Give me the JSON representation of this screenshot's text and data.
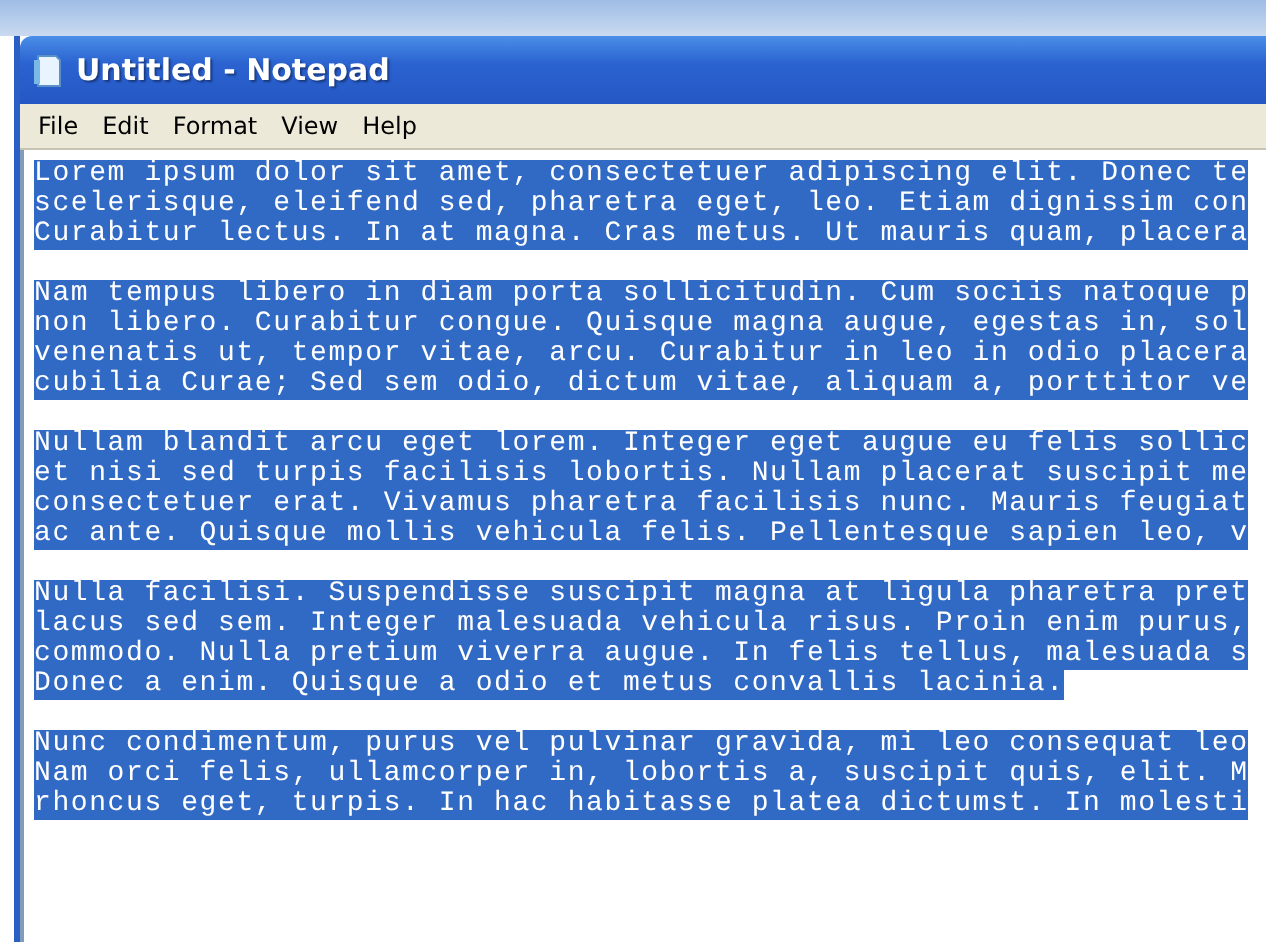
{
  "window": {
    "title": "Untitled - Notepad"
  },
  "menu": [
    "File",
    "Edit",
    "Format",
    "View",
    "Help"
  ],
  "paragraphs": [
    {
      "lines": [
        {
          "text": "Lorem ipsum dolor sit amet, consectetuer adipiscing elit. Donec te",
          "selected": true
        },
        {
          "text": "scelerisque, eleifend sed, pharetra eget, leo. Etiam dignissim con",
          "selected": true
        },
        {
          "text": "Curabitur lectus. In at magna. Cras metus. Ut mauris quam, placera",
          "selected": true
        }
      ]
    },
    {
      "lines": [
        {
          "text": "Nam tempus libero in diam porta sollicitudin. Cum sociis natoque p",
          "selected": true
        },
        {
          "text": "non libero. Curabitur congue. Quisque magna augue, egestas in, sol",
          "selected": true
        },
        {
          "text": "venenatis ut, tempor vitae, arcu. Curabitur in leo in odio placera",
          "selected": true
        },
        {
          "text": "cubilia Curae; Sed sem odio, dictum vitae, aliquam a, porttitor ve",
          "selected": true
        }
      ]
    },
    {
      "lines": [
        {
          "text": "Nullam blandit arcu eget lorem. Integer eget augue eu felis sollic",
          "selected": true
        },
        {
          "text": "et nisi sed turpis facilisis lobortis. Nullam placerat suscipit me",
          "selected": true
        },
        {
          "text": "consectetuer erat. Vivamus pharetra facilisis nunc. Mauris feugiat",
          "selected": true
        },
        {
          "text": "ac ante. Quisque mollis vehicula felis. Pellentesque sapien leo, v",
          "selected": true
        }
      ]
    },
    {
      "lines": [
        {
          "text": "Nulla facilisi. Suspendisse suscipit magna at ligula pharetra pret",
          "selected": true
        },
        {
          "text": "lacus sed sem. Integer malesuada vehicula risus. Proin enim purus,",
          "selected": true
        },
        {
          "text": "commodo. Nulla pretium viverra augue. In felis tellus, malesuada s",
          "selected": true
        },
        {
          "text": "Donec a enim. Quisque a odio et metus convallis lacinia.",
          "selected": true
        }
      ]
    },
    {
      "lines": [
        {
          "text": "Nunc condimentum, purus vel pulvinar gravida, mi leo consequat leo",
          "selected": true
        },
        {
          "text": "Nam orci felis, ullamcorper in, lobortis a, suscipit quis, elit. M",
          "selected": true
        },
        {
          "text": "rhoncus eget, turpis. In hac habitasse platea dictumst. In molesti",
          "selected": true
        }
      ]
    }
  ]
}
